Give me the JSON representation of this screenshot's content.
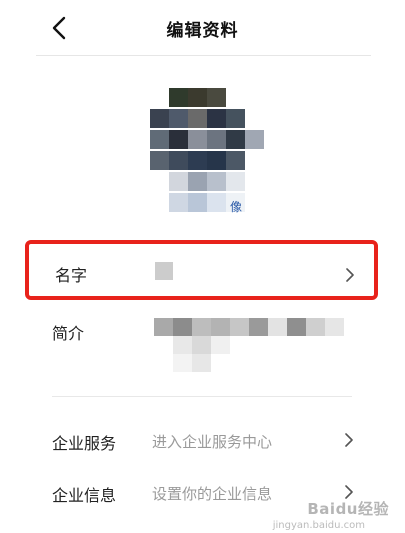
{
  "header": {
    "title": "编辑资料",
    "back_icon": "chevron-left-icon"
  },
  "avatar": {
    "edit_label": "像"
  },
  "fields": {
    "name": {
      "label": "名字",
      "chevron_icon": "chevron-right-icon",
      "highlight_color": "#e8221b"
    },
    "bio": {
      "label": "简介"
    }
  },
  "enterprise": {
    "service": {
      "label": "企业服务",
      "value": "进入企业服务中心",
      "chevron_icon": "chevron-right-icon"
    },
    "info": {
      "label": "企业信息",
      "value": "设置你的企业信息",
      "chevron_icon": "chevron-right-icon"
    }
  },
  "watermark": {
    "text": "Baidu经验",
    "sub": "jingyan.baidu.com"
  }
}
